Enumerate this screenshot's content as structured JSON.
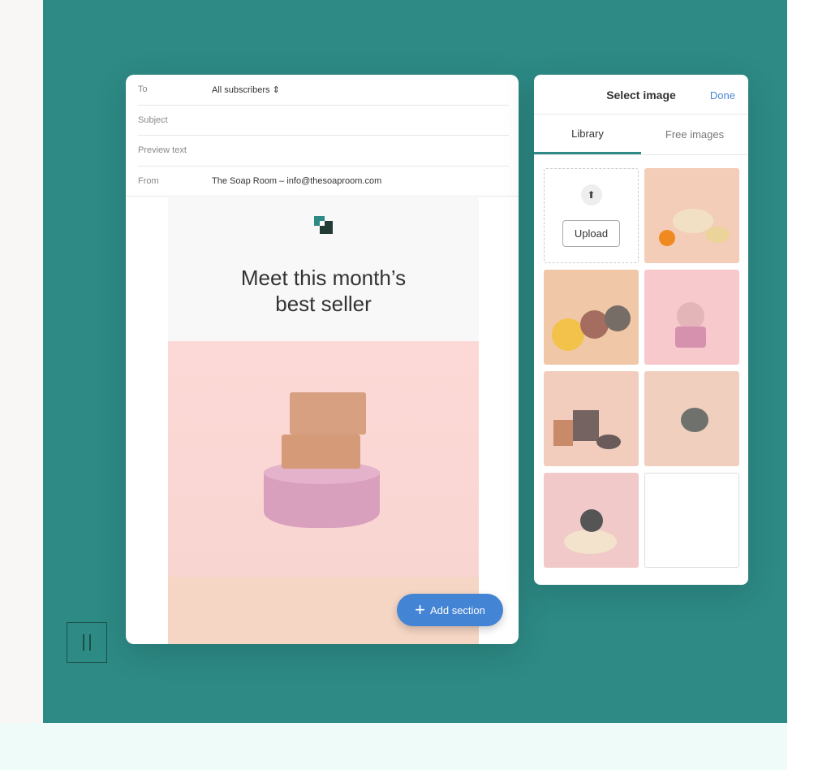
{
  "editor": {
    "to": {
      "label": "To",
      "value": "All subscribers ⇕"
    },
    "subject": {
      "label": "Subject",
      "value": ""
    },
    "preview": {
      "label": "Preview text",
      "value": ""
    },
    "from": {
      "label": "From",
      "value": "The Soap Room  –  info@thesoaproom.com"
    },
    "headline_1": "Meet this month’s",
    "headline_2": "best seller",
    "add_section": "Add section"
  },
  "panel": {
    "title": "Select image",
    "done": "Done",
    "tabs": [
      {
        "label": "Library",
        "active": true
      },
      {
        "label": "Free images",
        "active": false
      }
    ],
    "upload": "Upload"
  },
  "colors": {
    "teal": "#2d8a85",
    "accent": "#4484d4"
  }
}
